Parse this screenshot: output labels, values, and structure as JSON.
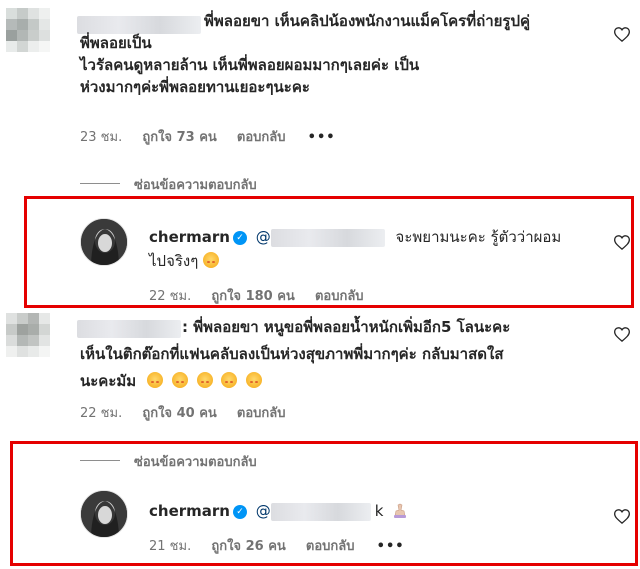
{
  "comments": [
    {
      "text_line1": "พี่พลอยขา เห็นคลิปน้องพนักงานแม็คโครที่ถ่ายรูปคู่",
      "text_line2": "พี่พลอยเป็น",
      "text_line3": "ไวรัลคนดูหลายล้าน เห็นพี่พลอยผอมมากๆเลยค่ะ เป็น",
      "text_line4": "ห่วงมากๆค่ะพี่พลอยทานเยอะๆนะคะ",
      "time": "23 ชม.",
      "likes": "ถูกใจ 73 คน",
      "reply_label": "ตอบกลับ",
      "more": "•••"
    },
    {
      "text_line1": ": พี่พลอยขา หนูขอพี่พลอยน้ำหนักเพิ่มอีก5 โลนะคะ",
      "text_line2": "เห็นในติกต๊อกที่แฟนคลับลงเป็นห่วงสุขภาพพี่มากๆค่ะ กลับมาสดใส",
      "text_line3": "นะคะมัม",
      "time": "22 ชม.",
      "likes": "ถูกใจ 40 คน",
      "reply_label": "ตอบกลับ"
    }
  ],
  "hide_replies_label": "ซ่อนข้อความตอบกลับ",
  "replies": [
    {
      "username": "chermarn",
      "mention_prefix": "@",
      "mention_suffix": "จะพยามนะคะ รู้ตัวว่าผอม",
      "text_line2": "ไปจริงๆ",
      "time": "22 ชม.",
      "likes": "ถูกใจ 180 คน",
      "reply_label": "ตอบกลับ"
    },
    {
      "username": "chermarn",
      "mention_prefix": "@",
      "mention_suffix": "k",
      "time": "21 ชม.",
      "likes": "ถูกใจ 26 คน",
      "reply_label": "ตอบกลับ",
      "more": "•••"
    }
  ],
  "icons": {
    "heart": "heart-icon",
    "verified": "verified-badge-icon",
    "emoji": "emoji-icon",
    "more": "more-options-icon"
  },
  "colors": {
    "highlight_box": "#e50000",
    "verified": "#0095f6",
    "meta_text": "#737373"
  }
}
